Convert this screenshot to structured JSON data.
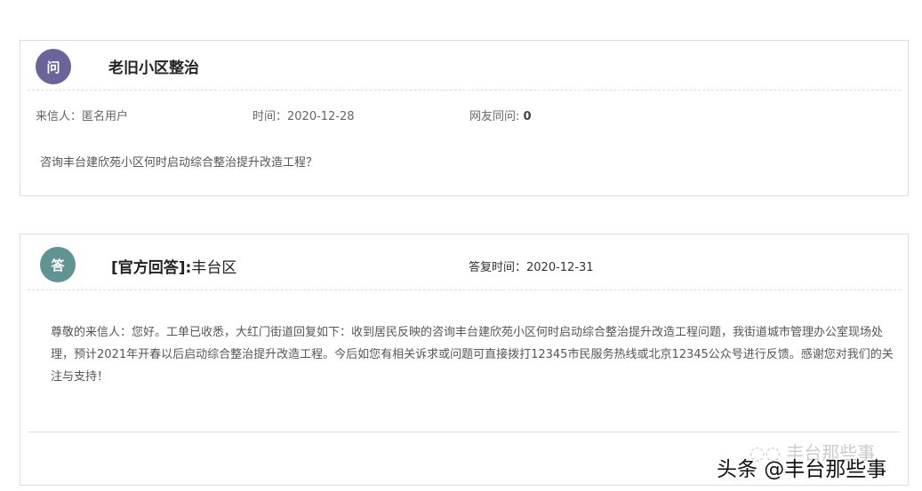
{
  "colors": {
    "question": "#69649a",
    "answer": "#5f9492"
  },
  "question": {
    "badge": "问",
    "title": "老旧小区整治",
    "sender_label": "来信人：",
    "sender": "匿名用户",
    "time_label": "时间：",
    "time": "2020-12-28",
    "same_label": "网友同问:",
    "same_count": "0",
    "content": "咨询丰台建欣苑小区何时启动综合整治提升改造工程？"
  },
  "answer": {
    "badge": "答",
    "official": "[官方回答]:",
    "org": "丰台区",
    "time_label": "答复时间：",
    "time": "2020-12-31",
    "content": "尊敬的来信人：您好。工单已收悉，大红门街道回复如下：收到居民反映的咨询丰台建欣苑小区何时启动综合整治提升改造工程问题，我街道城市管理办公室现场处理，预计2021年开春以后启动综合整治提升改造工程。今后如您有相关诉求或问题可直接拨打12345市民服务热线或北京12345公众号进行反馈。感谢您对我们的关注与支持！"
  },
  "watermark": {
    "wechat": "丰台那些事",
    "toutiao": "头条 @丰台那些事"
  }
}
